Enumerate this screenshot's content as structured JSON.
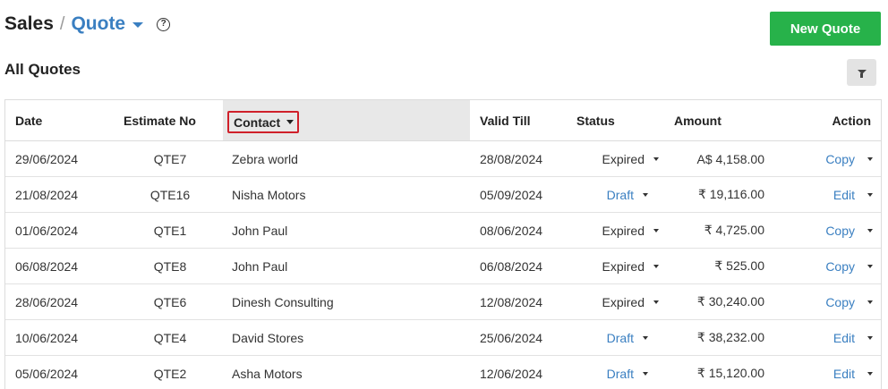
{
  "breadcrumb": {
    "root": "Sales",
    "separator": "/",
    "current": "Quote",
    "help": "?"
  },
  "toolbar": {
    "new_label": "New Quote"
  },
  "section": {
    "title": "All Quotes"
  },
  "table": {
    "columns": {
      "date": "Date",
      "estimate": "Estimate No",
      "contact": "Contact",
      "valid": "Valid Till",
      "status": "Status",
      "amount": "Amount",
      "action": "Action"
    },
    "sorted_column": "contact",
    "rows": [
      {
        "date": "29/06/2024",
        "estimate": "QTE7",
        "contact": "Zebra world",
        "valid": "28/08/2024",
        "status": "Expired",
        "amount": "A$ 4,158.00",
        "action": "Copy"
      },
      {
        "date": "21/08/2024",
        "estimate": "QTE16",
        "contact": "Nisha Motors",
        "valid": "05/09/2024",
        "status": "Draft",
        "amount": "₹ 19,116.00",
        "action": "Edit"
      },
      {
        "date": "01/06/2024",
        "estimate": "QTE1",
        "contact": "John Paul",
        "valid": "08/06/2024",
        "status": "Expired",
        "amount": "₹ 4,725.00",
        "action": "Copy"
      },
      {
        "date": "06/08/2024",
        "estimate": "QTE8",
        "contact": "John Paul",
        "valid": "06/08/2024",
        "status": "Expired",
        "amount": "₹ 525.00",
        "action": "Copy"
      },
      {
        "date": "28/06/2024",
        "estimate": "QTE6",
        "contact": "Dinesh Consulting",
        "valid": "12/08/2024",
        "status": "Expired",
        "amount": "₹ 30,240.00",
        "action": "Copy"
      },
      {
        "date": "10/06/2024",
        "estimate": "QTE4",
        "contact": "David Stores",
        "valid": "25/06/2024",
        "status": "Draft",
        "amount": "₹ 38,232.00",
        "action": "Edit"
      },
      {
        "date": "05/06/2024",
        "estimate": "QTE2",
        "contact": "Asha Motors",
        "valid": "12/06/2024",
        "status": "Draft",
        "amount": "₹ 15,120.00",
        "action": "Edit"
      }
    ]
  },
  "icons": {
    "breadcrumb_dropdown": "caret-down-icon",
    "help": "help-circle-icon",
    "filter": "filter-icon",
    "row_dropdown": "caret-down-icon"
  },
  "colors": {
    "primary_button": "#27b24a",
    "link": "#3a7fc1",
    "highlight_border": "#d0202a",
    "sorted_header_bg": "#e8e8e8"
  }
}
